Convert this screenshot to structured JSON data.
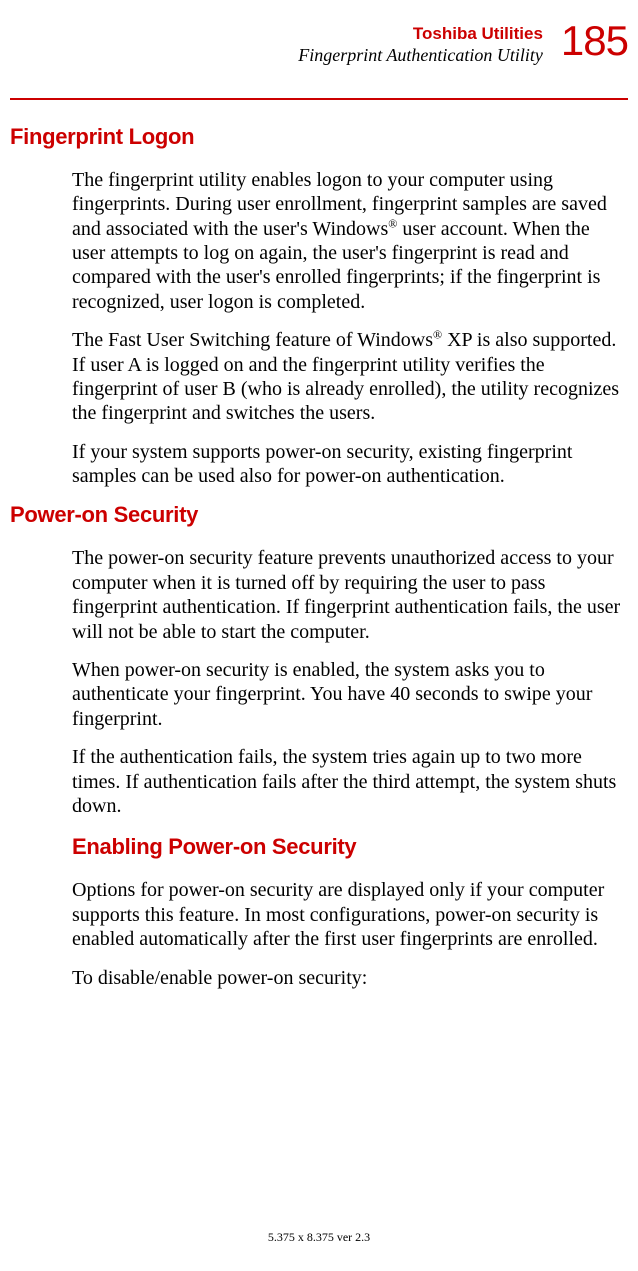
{
  "header": {
    "title": "Toshiba Utilities",
    "subtitle": "Fingerprint Authentication Utility",
    "page_number": "185"
  },
  "sections": {
    "s1": {
      "heading": "Fingerprint Logon",
      "p1_a": "The fingerprint utility enables logon to your computer using fingerprints. During user enrollment, fingerprint samples are saved and associated with the user's Windows",
      "p1_sup1": "®",
      "p1_b": " user account. When the user attempts to log on again, the user's fingerprint is read and compared with the user's enrolled fingerprints; if the fingerprint is recognized, user logon is completed.",
      "p2_a": "The Fast User Switching feature of Windows",
      "p2_sup1": "®",
      "p2_b": " XP is also supported. If user A is logged on and the fingerprint utility verifies the fingerprint of user B (who is already enrolled), the utility recognizes the fingerprint and switches the users.",
      "p3": "If your system supports power-on security, existing fingerprint samples can be used also for power-on authentication."
    },
    "s2": {
      "heading": "Power-on Security",
      "p1": "The power-on security feature prevents unauthorized access to your computer when it is turned off by requiring the user to pass fingerprint authentication. If fingerprint authentication fails, the user will not be able to start the computer.",
      "p2": "When power-on security is enabled, the system asks you to authenticate your fingerprint. You have 40 seconds to swipe your fingerprint.",
      "p3": "If the authentication fails, the system tries again up to two more times. If authentication fails after the third attempt, the system shuts down."
    },
    "s3": {
      "heading": "Enabling Power-on Security",
      "p1": "Options for power-on security are displayed only if your computer supports this feature. In most configurations, power-on security is enabled automatically after the first user fingerprints are enrolled.",
      "p2": "To disable/enable power-on security:"
    }
  },
  "footer": "5.375 x 8.375 ver 2.3"
}
